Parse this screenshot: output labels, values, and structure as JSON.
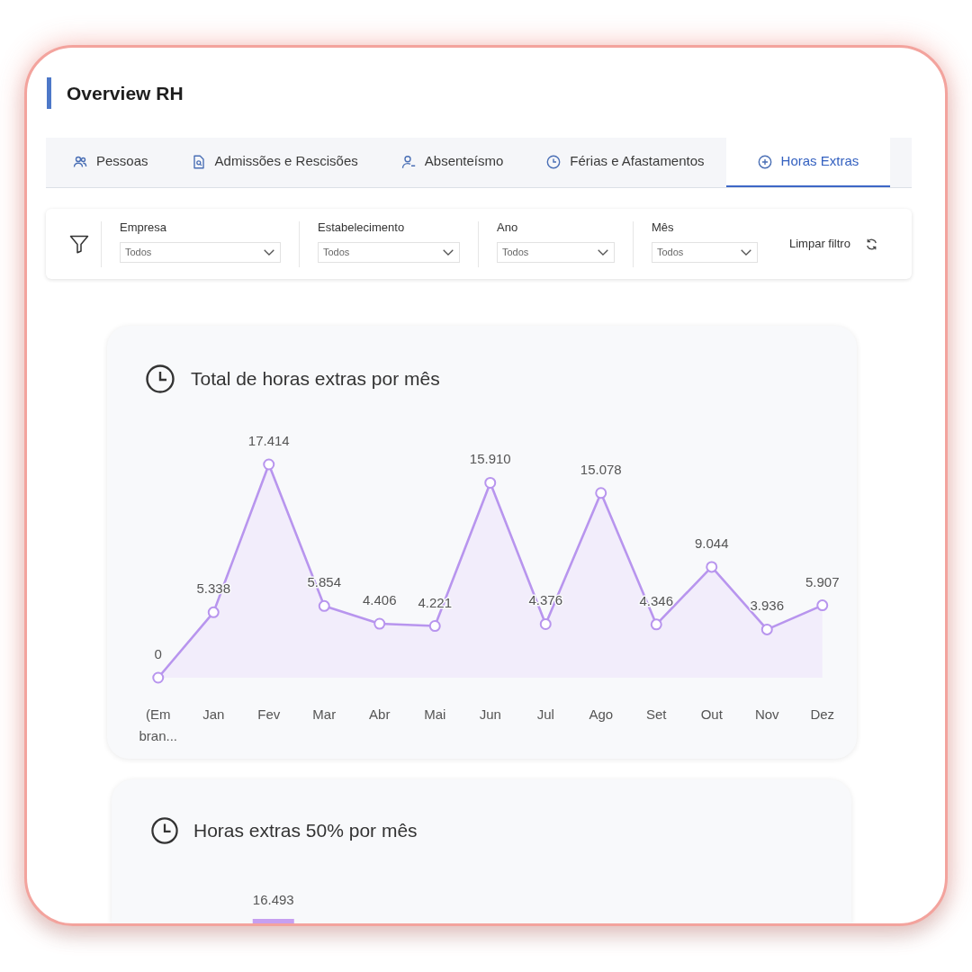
{
  "header": {
    "title": "Overview RH"
  },
  "tabs": [
    {
      "label": "Pessoas",
      "selected": false
    },
    {
      "label": "Admissões e Rescisões",
      "selected": false
    },
    {
      "label": "Absenteísmo",
      "selected": false
    },
    {
      "label": "Férias e Afastamentos",
      "selected": false
    },
    {
      "label": "Horas Extras",
      "selected": true
    }
  ],
  "filters": {
    "fields": [
      {
        "label": "Empresa",
        "value": "Todos"
      },
      {
        "label": "Estabelecimento",
        "value": "Todos"
      },
      {
        "label": "Ano",
        "value": "Todos"
      },
      {
        "label": "Mês",
        "value": "Todos"
      }
    ],
    "clear_button": "Limpar filtro"
  },
  "cards": [
    {
      "chart_data": {
        "type": "area",
        "title": "Total de horas extras por mês",
        "categories": [
          "(Em bran...",
          "Jan",
          "Fev",
          "Mar",
          "Abr",
          "Mai",
          "Jun",
          "Jul",
          "Ago",
          "Set",
          "Out",
          "Nov",
          "Dez"
        ],
        "values": [
          0,
          5338,
          17414,
          5854,
          4406,
          4221,
          15910,
          4376,
          15078,
          4346,
          9044,
          3936,
          5907
        ],
        "value_labels": [
          "0",
          "5.338",
          "17.414",
          "5.854",
          "4.406",
          "4.221",
          "15.910",
          "4.376",
          "15.078",
          "4.346",
          "9.044",
          "3.936",
          "5.907"
        ]
      }
    },
    {
      "title": "Horas extras 50% por mês",
      "bar_label": "16.493"
    }
  ]
}
